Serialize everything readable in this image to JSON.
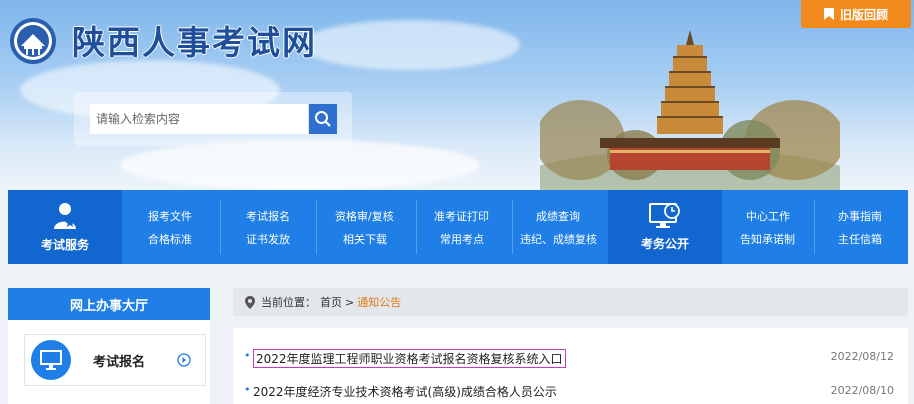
{
  "header": {
    "site_title": "陕西人事考试网",
    "old_version_label": "旧版回顾",
    "search": {
      "placeholder": "请输入检索内容"
    }
  },
  "nav": {
    "exam_service_label": "考试服务",
    "exam_public_label": "考务公开",
    "links": {
      "bkwj": "报考文件",
      "hgbz": "合格标准",
      "ksbm": "考试报名",
      "zsff": "证书发放",
      "zgsfj": "资格审/复核",
      "xgxz": "相关下载",
      "zkzdy": "准考证打印",
      "cykd": "常用考点",
      "cjcx": "成绩查询",
      "wjcjfh": "违纪、成绩复核",
      "zxgz": "中心工作",
      "gzcnz": "告知承诺制",
      "bszn": "办事指南",
      "zrxx": "主任信箱"
    }
  },
  "left_panel": {
    "title": "网上办事大厅",
    "item_label": "考试报名"
  },
  "breadcrumb": {
    "label": "当前位置：",
    "home": "首页",
    "sep": ">",
    "current": "通知公告"
  },
  "news": [
    {
      "title": "2022年度监理工程师职业资格考试报名资格复核系统入口",
      "date": "2022/08/12"
    },
    {
      "title": "2022年度经济专业技术资格考试(高级)成绩合格人员公示",
      "date": "2022/08/10"
    }
  ],
  "colors": {
    "primary_blue": "#1f7fe6",
    "dark_blue": "#1266cf",
    "orange": "#f28a1d",
    "highlight": "#c03fb8"
  }
}
